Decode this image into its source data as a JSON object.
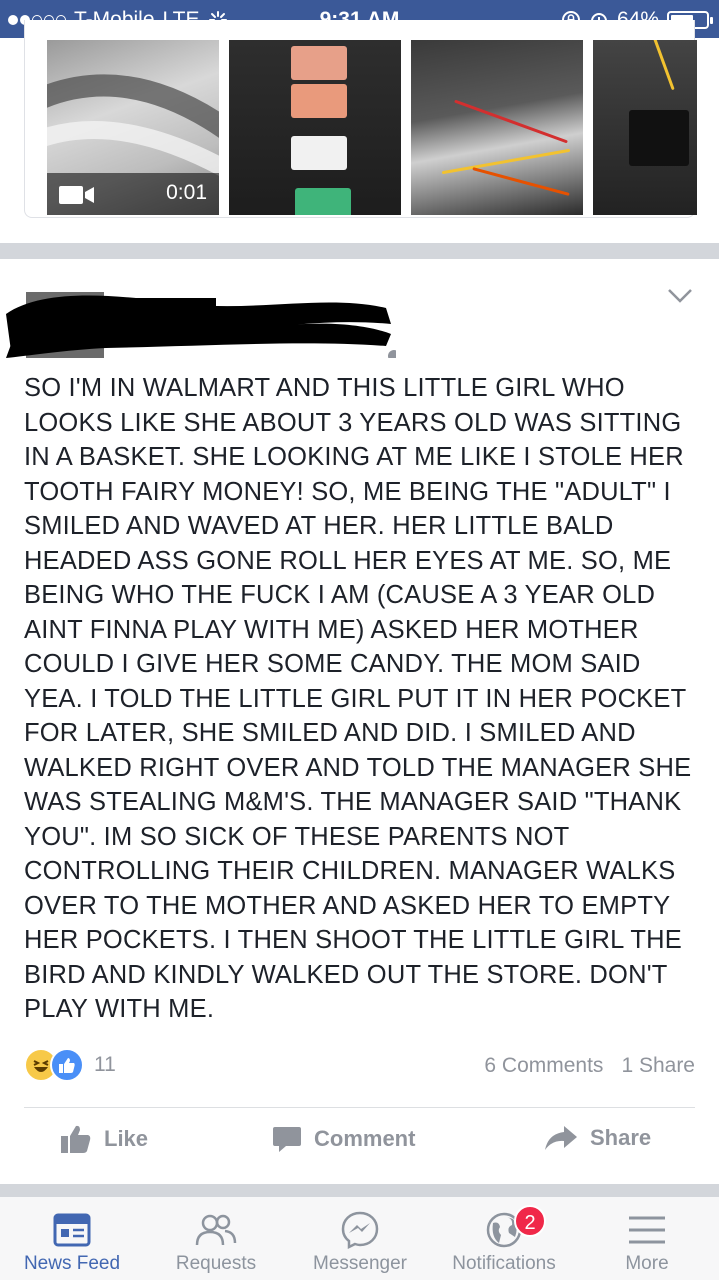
{
  "status_bar": {
    "carrier": "T-Mobile",
    "network": "LTE",
    "time": "9:31 AM",
    "battery_percent": "64%",
    "battery_level": 0.64
  },
  "media": {
    "video_duration": "0:01"
  },
  "post": {
    "body": "SO I'M IN WALMART AND THIS LITTLE GIRL WHO LOOKS LIKE SHE ABOUT 3 YEARS OLD WAS SITTING IN A BASKET. SHE LOOKING AT ME LIKE I STOLE HER TOOTH FAIRY MONEY! SO, ME BEING THE \"ADULT\" I SMILED AND WAVED AT HER. HER LITTLE BALD HEADED ASS GONE ROLL HER EYES AT ME. SO, ME BEING WHO THE FUCK I AM (CAUSE A 3 YEAR OLD AINT FINNA PLAY WITH ME) ASKED HER MOTHER COULD I GIVE HER SOME CANDY. THE MOM SAID YEA. I TOLD THE LITTLE GIRL PUT IT IN HER POCKET FOR LATER, SHE SMILED AND DID. I SMILED AND WALKED RIGHT OVER AND TOLD THE MANAGER SHE WAS STEALING M&M'S. THE MANAGER SAID \"THANK YOU\". IM SO SICK OF THESE PARENTS NOT CONTROLLING THEIR CHILDREN. MANAGER WALKS OVER TO THE MOTHER AND ASKED HER TO EMPTY HER POCKETS. I THEN SHOOT THE LITTLE GIRL THE BIRD AND KINDLY WALKED OUT THE STORE. DON'T PLAY WITH ME.",
    "reaction_count": "11",
    "comments": "6 Comments",
    "shares": "1 Share",
    "actions": {
      "like": "Like",
      "comment": "Comment",
      "share": "Share"
    }
  },
  "tabbar": {
    "tabs": [
      {
        "label": "News Feed",
        "icon": "news-feed-icon",
        "active": true
      },
      {
        "label": "Requests",
        "icon": "friend-requests-icon"
      },
      {
        "label": "Messenger",
        "icon": "messenger-icon"
      },
      {
        "label": "Notifications",
        "icon": "globe-icon",
        "badge": "2"
      },
      {
        "label": "More",
        "icon": "menu-icon"
      }
    ]
  },
  "colors": {
    "brand": "#3b5998",
    "active_tab": "#4267b2",
    "badge": "#f02849"
  }
}
